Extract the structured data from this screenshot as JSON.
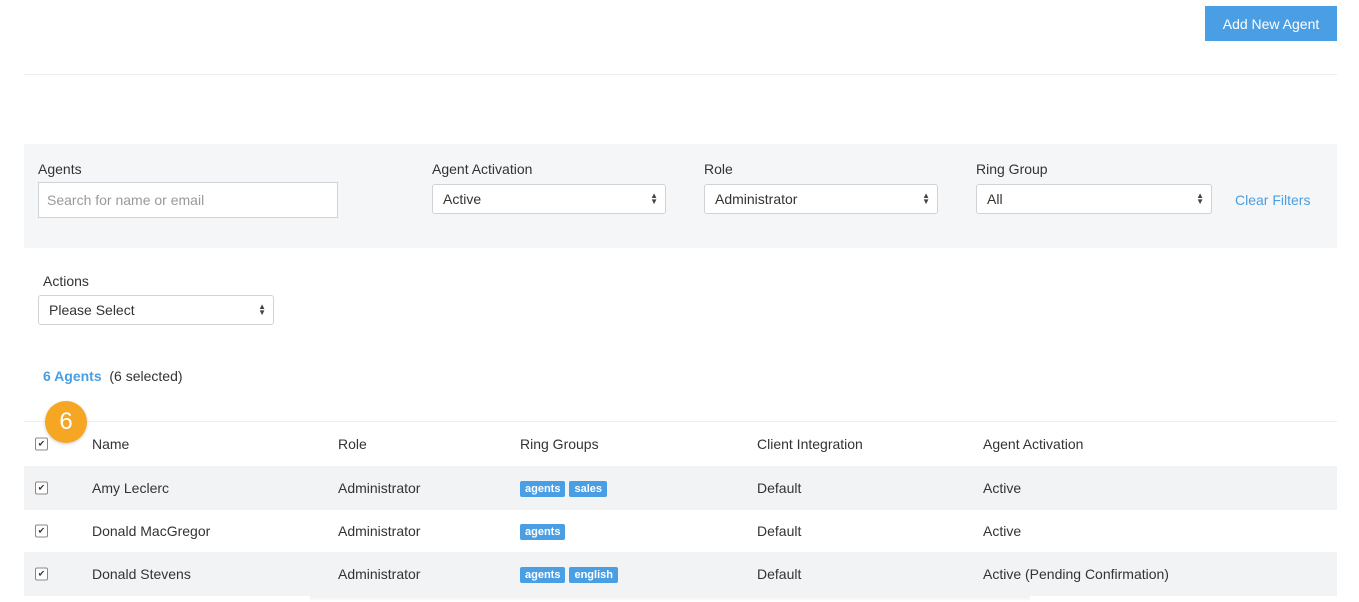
{
  "header": {
    "add_agent_label": "Add New Agent"
  },
  "filters": {
    "agents_label": "Agents",
    "agents_placeholder": "Search for name or email",
    "activation_label": "Agent Activation",
    "activation_value": "Active",
    "role_label": "Role",
    "role_value": "Administrator",
    "ring_group_label": "Ring Group",
    "ring_group_value": "All",
    "clear_label": "Clear Filters"
  },
  "actions": {
    "label": "Actions",
    "value": "Please Select"
  },
  "summary": {
    "count_label": "6 Agents",
    "selected_label": "(6 selected)",
    "badge": "6"
  },
  "table": {
    "columns": [
      "Name",
      "Role",
      "Ring Groups",
      "Client Integration",
      "Agent Activation"
    ],
    "rows": [
      {
        "name": "Amy Leclerc",
        "role": "Administrator",
        "groups": [
          "agents",
          "sales"
        ],
        "integration": "Default",
        "activation": "Active"
      },
      {
        "name": "Donald MacGregor",
        "role": "Administrator",
        "groups": [
          "agents"
        ],
        "integration": "Default",
        "activation": "Active"
      },
      {
        "name": "Donald Stevens",
        "role": "Administrator",
        "groups": [
          "agents",
          "english"
        ],
        "integration": "Default",
        "activation": "Active (Pending Confirmation)"
      }
    ]
  },
  "colors": {
    "accent": "#4a9ee4",
    "badge": "#f5a623",
    "filter_bg": "#f5f6f7",
    "row_alt": "#f2f3f4"
  }
}
